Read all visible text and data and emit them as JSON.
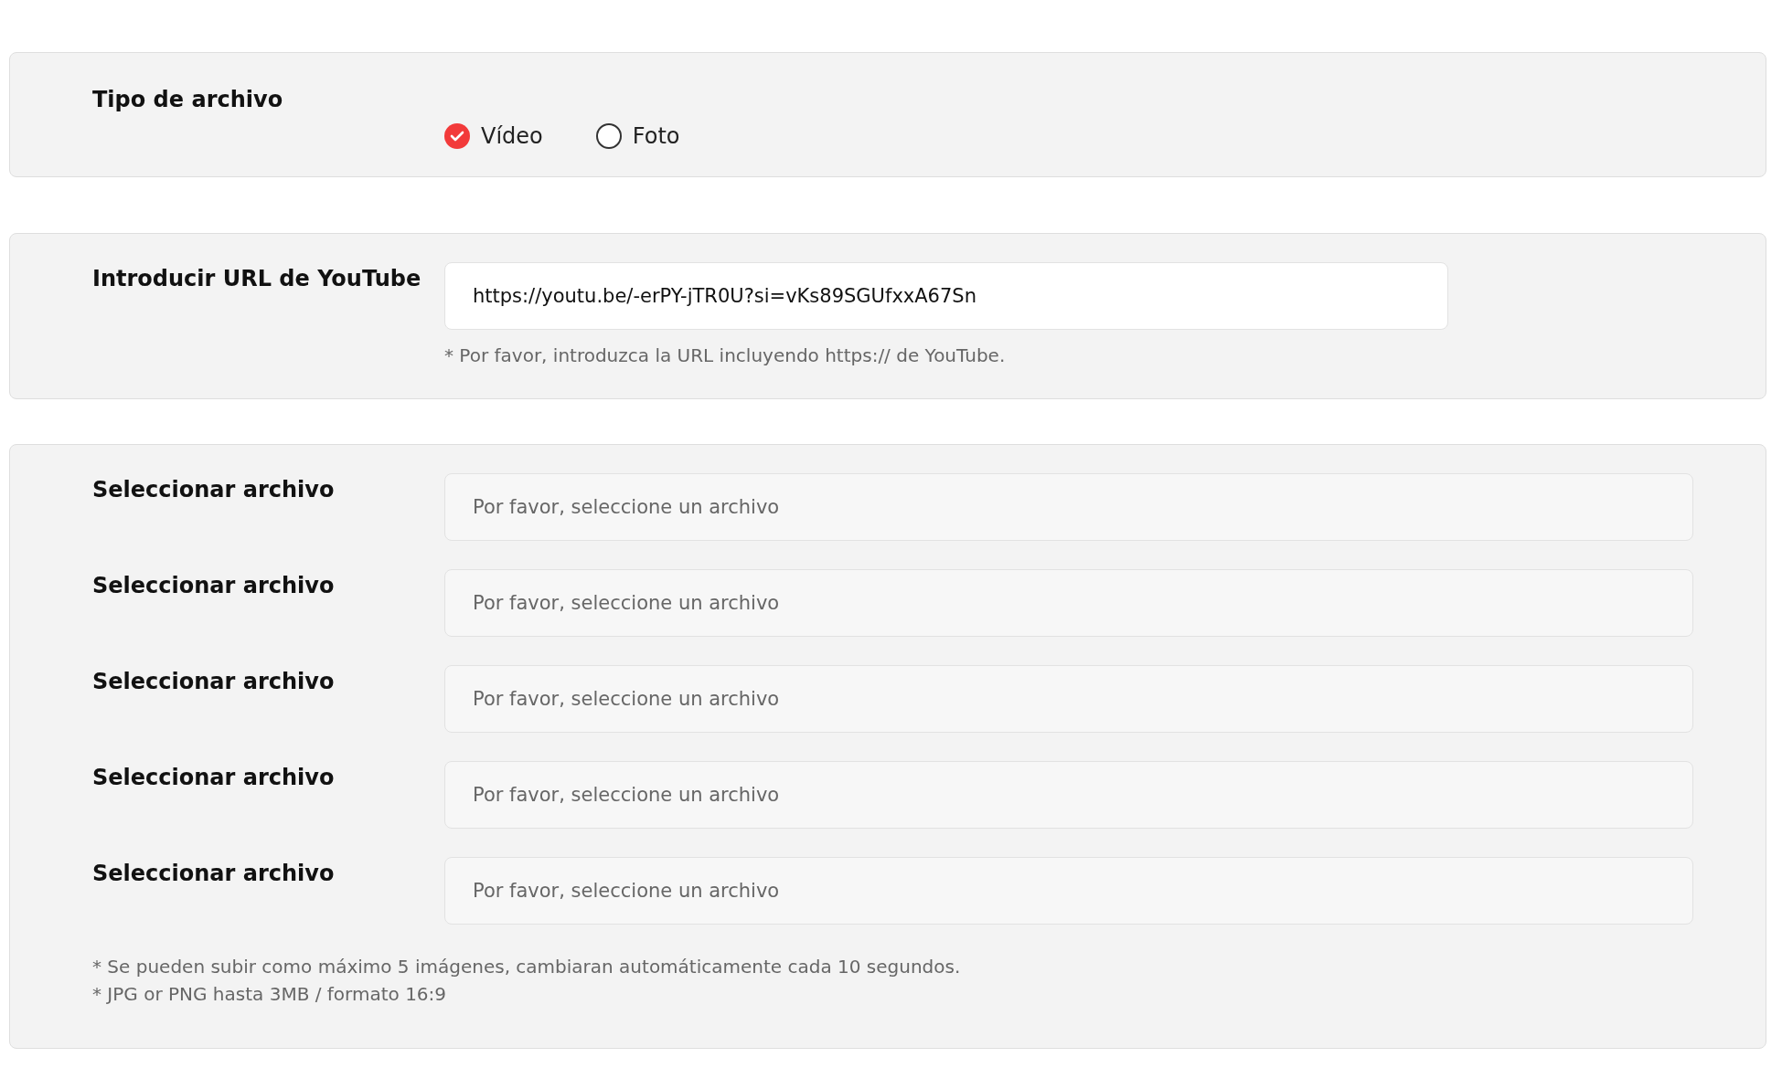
{
  "file_type": {
    "label": "Tipo de archivo",
    "options": [
      {
        "label": "Vídeo",
        "selected": true
      },
      {
        "label": "Foto",
        "selected": false
      }
    ]
  },
  "youtube": {
    "label": "Introducir URL de YouTube",
    "value": "https://youtu.be/-erPY-jTR0U?si=vKs89SGUfxxA67Sn",
    "hint": "* Por favor, introduzca la URL incluyendo https:// de YouTube."
  },
  "files": [
    {
      "label": "Seleccionar archivo",
      "placeholder": "Por favor, seleccione un archivo"
    },
    {
      "label": "Seleccionar archivo",
      "placeholder": "Por favor, seleccione un archivo"
    },
    {
      "label": "Seleccionar archivo",
      "placeholder": "Por favor, seleccione un archivo"
    },
    {
      "label": "Seleccionar archivo",
      "placeholder": "Por favor, seleccione un archivo"
    },
    {
      "label": "Seleccionar archivo",
      "placeholder": "Por favor, seleccione un archivo"
    }
  ],
  "notes": [
    "* Se pueden subir como máximo 5 imágenes, cambiaran automáticamente cada 10 segundos.",
    "* JPG or PNG hasta 3MB / formato 16:9"
  ]
}
